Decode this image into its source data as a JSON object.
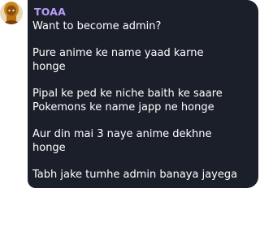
{
  "message": {
    "sender": "TOAA",
    "sender_color": "#b69df8",
    "bubble_color": "#1b1f2a",
    "avatar_icon": "avatar-icon",
    "lines": [
      "Want to become admin?",
      "Pure anime ke name yaad karne",
      "honge",
      "Pipal ke ped ke niche baith ke saare",
      "Pokemons ke name japp ne honge",
      "Aur din mai 3 naye anime dekhne",
      "honge",
      "Tabh jake tumhe admin banaya jayega"
    ]
  }
}
